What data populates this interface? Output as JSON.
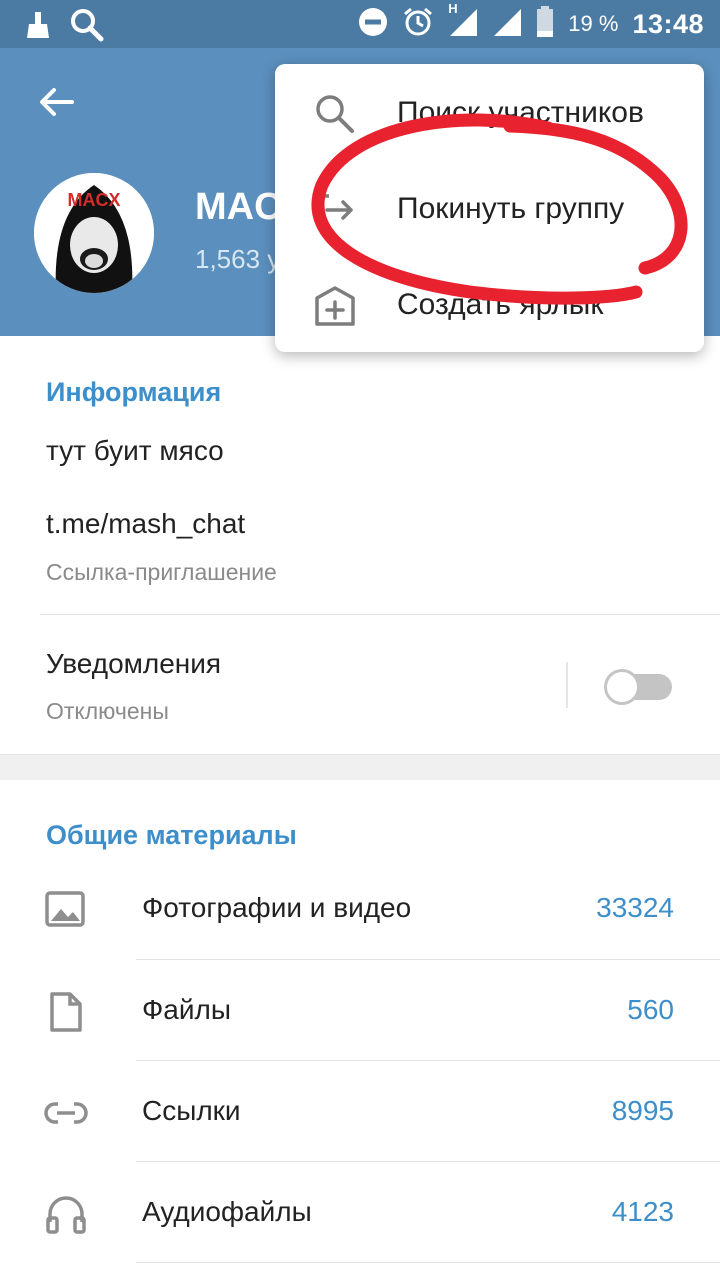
{
  "status_bar": {
    "network_badge": "H",
    "battery_percent": "19 %",
    "time": "13:48",
    "icons": [
      "cleaner-icon",
      "search-icon",
      "do-not-disturb-icon",
      "alarm-icon",
      "signal-icon",
      "signal-icon",
      "battery-icon"
    ]
  },
  "header": {
    "group_name": "MACX",
    "member_count": "1,563 y",
    "avatar_text": "MACX"
  },
  "menu": {
    "items": [
      {
        "label": "Поиск участников",
        "icon": "search-icon"
      },
      {
        "label": "Покинуть группу",
        "icon": "leave-icon"
      },
      {
        "label": "Создать ярлык",
        "icon": "add-shortcut-icon"
      }
    ]
  },
  "info": {
    "title": "Информация",
    "description": "тут буит мясо",
    "link": "t.me/mash_chat",
    "link_caption": "Ссылка-приглашение",
    "notifications_label": "Уведомления",
    "notifications_status": "Отключены",
    "notifications_enabled": false
  },
  "media": {
    "title": "Общие материалы",
    "items": [
      {
        "label": "Фотографии и видео",
        "count": "33324",
        "icon": "photo-icon"
      },
      {
        "label": "Файлы",
        "count": "560",
        "icon": "file-icon"
      },
      {
        "label": "Ссылки",
        "count": "8995",
        "icon": "link-icon"
      },
      {
        "label": "Аудиофайлы",
        "count": "4123",
        "icon": "headphones-icon"
      }
    ]
  },
  "colors": {
    "status_bar": "#4b7aa3",
    "header": "#5b8fbd",
    "accent": "#3d8fcb",
    "annotation": "#e8232f"
  }
}
